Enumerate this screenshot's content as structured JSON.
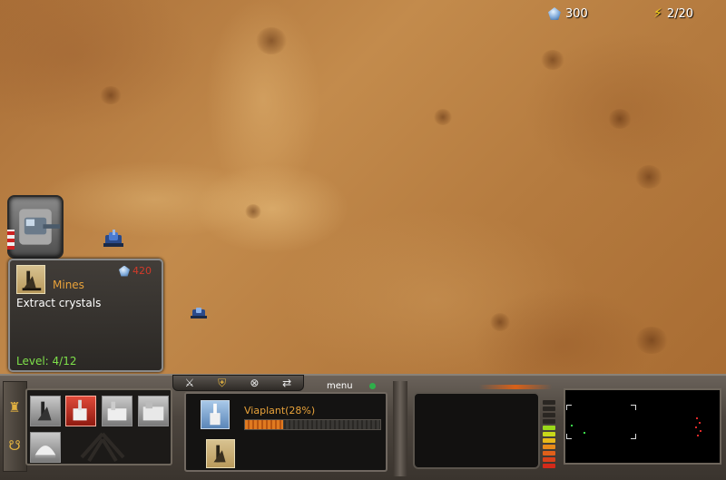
{
  "resources": {
    "crystals": "300",
    "energy": "2/20",
    "crystal_icon": "crystal-gem-icon",
    "energy_icon": "lightning-bolt-icon"
  },
  "info_panel": {
    "title": "Mines",
    "cost": "420",
    "description": "Extract crystals",
    "level": "Level: 4/12",
    "title_color": "#e8a23a",
    "cost_color": "#d23a2a",
    "level_color": "#7ee04a"
  },
  "toolbar": {
    "menu_label": "menu",
    "icons": [
      "sword-icon",
      "shield-icon",
      "cancel-circle-icon",
      "cycle-arrows-icon"
    ]
  },
  "production": {
    "label": "Viaplant(28%)",
    "progress": 0.28
  },
  "build_options": [
    "mine-building",
    "viaplant-building",
    "factory-building",
    "refinery-building",
    "dome-building"
  ],
  "side_tabs": [
    "soldier-icon",
    "creature-icon"
  ],
  "energy_meter": {
    "level": 0.6
  }
}
